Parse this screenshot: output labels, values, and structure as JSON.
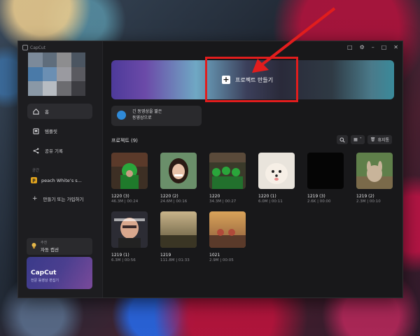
{
  "app": {
    "title": "CapCut"
  },
  "window_controls": [
    "feedback-icon",
    "settings-icon",
    "minimize-icon",
    "maximize-icon",
    "close-icon"
  ],
  "sidebar": {
    "nav": [
      {
        "label": "홈",
        "icon": "home-icon",
        "active": true
      },
      {
        "label": "템플릿",
        "icon": "template-icon",
        "active": false
      },
      {
        "label": "공유 기록",
        "icon": "share-icon",
        "active": false
      }
    ],
    "space_label": "공간",
    "space_item": {
      "badge": "p",
      "label": "peach White’s s..."
    },
    "join_label": "만들기 또는 가입하기",
    "recommend": {
      "tag": "추천",
      "label": "자동 캡션"
    },
    "promo": {
      "title": "CapCut",
      "subtitle": "전문 동영상 편집기"
    }
  },
  "main": {
    "new_project_label": "프로젝트 만들기",
    "long_video": {
      "line1": "긴 동영상을 짧은",
      "line2": "동영상으로"
    },
    "projects_title": "프로젝트 (9)",
    "trash_label": "휴지통",
    "projects": [
      {
        "name": "1220 (3)",
        "meta": "46.3M | 00:24"
      },
      {
        "name": "1220 (2)",
        "meta": "24.6M | 00:16"
      },
      {
        "name": "1220",
        "meta": "34.3M | 00:27"
      },
      {
        "name": "1220 (1)",
        "meta": "6.0M | 00:11"
      },
      {
        "name": "1219 (3)",
        "meta": "2.6K | 00:00"
      },
      {
        "name": "1219 (2)",
        "meta": "2.3M | 00:10"
      },
      {
        "name": "1219 (1)",
        "meta": "6.3M | 00:56"
      },
      {
        "name": "1219",
        "meta": "111.8M | 01:33"
      },
      {
        "name": "1021",
        "meta": "2.9M | 00:05"
      }
    ]
  },
  "colors": {
    "highlight": "#e11d1d",
    "accent": "#2f8ad8"
  }
}
